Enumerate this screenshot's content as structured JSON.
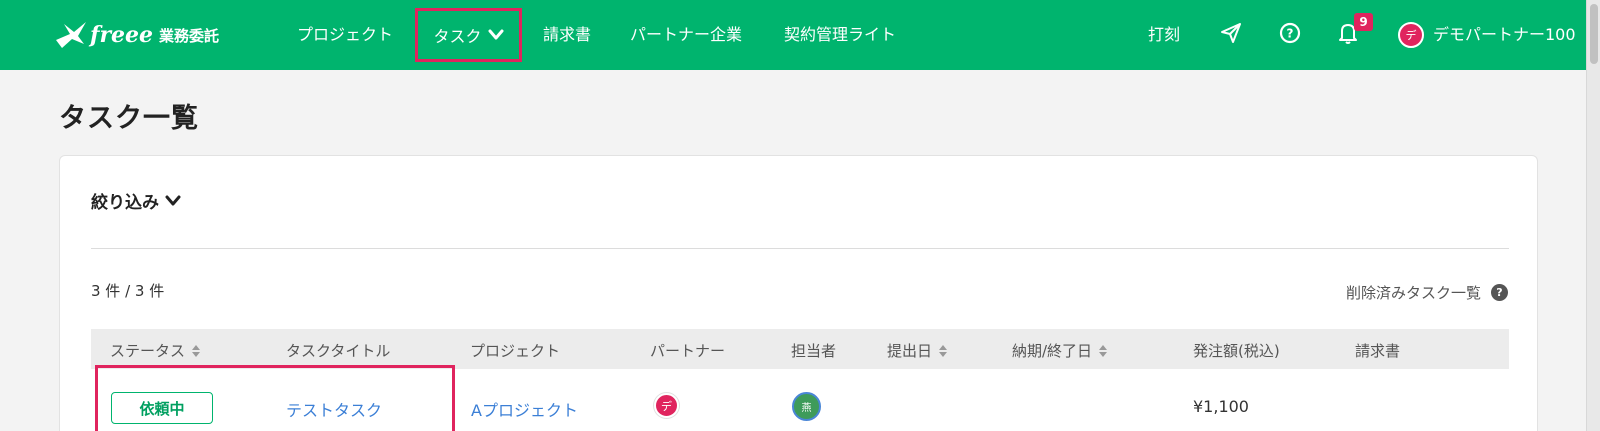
{
  "header": {
    "logo": {
      "word": "freee",
      "product": "業務委託"
    },
    "nav": [
      {
        "label": "プロジェクト"
      },
      {
        "label": "タスク"
      },
      {
        "label": "請求書"
      },
      {
        "label": "パートナー企業"
      },
      {
        "label": "契約管理ライト"
      }
    ],
    "timecard_label": "打刻",
    "notification_count": "9",
    "user": {
      "avatar_char": "デ",
      "name": "デモパートナー100"
    },
    "icons": [
      "paper-plane-icon",
      "help-icon",
      "bell-icon",
      "chevron-down-icon"
    ]
  },
  "page": {
    "title": "タスク一覧",
    "filter_label": "絞り込み",
    "count_text": "3 件 / 3 件",
    "deleted_link": "削除済みタスク一覧",
    "deleted_help": "?"
  },
  "table": {
    "columns": [
      "ステータス",
      "タスクタイトル",
      "プロジェクト",
      "パートナー",
      "担当者",
      "提出日",
      "納期/終了日",
      "発注額(税込)",
      "請求書"
    ],
    "rows": [
      {
        "status": "依頼中",
        "title": "テストタスク",
        "project": "Aプロジェクト",
        "partner_avatar": "デ",
        "assignee_avatar": "燕",
        "submitted": "",
        "due": "",
        "amount": "¥1,100",
        "invoice": ""
      }
    ]
  },
  "colors": {
    "brand_green": "#00b46e",
    "highlight": "#e0245e",
    "link": "#3b7fd6"
  }
}
